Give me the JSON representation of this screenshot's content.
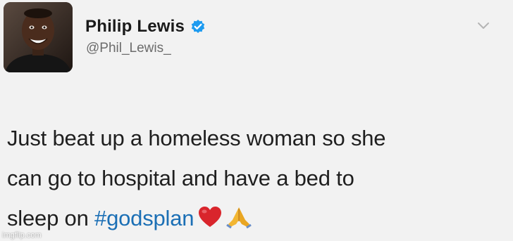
{
  "tweet": {
    "author": {
      "display_name": "Philip Lewis",
      "handle": "@Phil_Lewis_",
      "verified": true,
      "avatar_icon": "profile-photo"
    },
    "menu_icon": "chevron-down-icon",
    "text_lines": [
      "Just beat up a homeless woman so she",
      "can go to hospital and have a bed to",
      "sleep on"
    ],
    "hashtag": "#godsplan",
    "emojis": [
      "red-heart-icon",
      "folded-hands-icon"
    ]
  },
  "watermark": "imgflip.com",
  "colors": {
    "background": "#f2f2f2",
    "verified_badge": "#1d9bf0",
    "hashtag": "#1b6fb5",
    "chevron": "#b5b5b5"
  }
}
